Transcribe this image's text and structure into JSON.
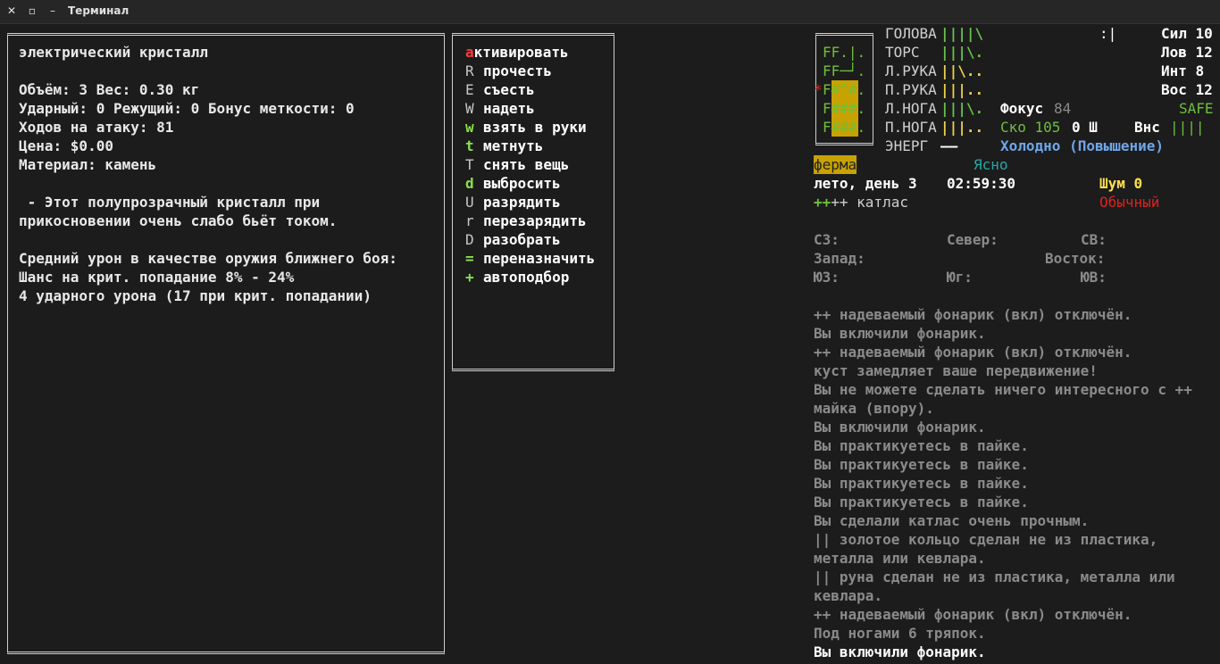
{
  "window": {
    "title": "Терминал",
    "close_icon": "✕",
    "maximize_icon": "▫",
    "minimize_icon": "–"
  },
  "item_info": {
    "name": "электрический кристалл",
    "volume_weight": "Объём: 3 Вес: 0.30 кг",
    "damage": "Ударный: 0 Режущий: 0 Бонус меткости: 0",
    "moves": "Ходов на атаку: 81",
    "price": "Цена: $0.00",
    "material": "Материал: камень",
    "desc_1": " - Этот полупрозрачный кристалл при",
    "desc_2": "прикосновении очень слабо бьёт током.",
    "melee_1": "Средний урон в качестве оружия ближнего боя:",
    "melee_2": "Шанс на крит. попадание 8% - 24%",
    "melee_3": "4 ударного урона (17 при крит. попадании)"
  },
  "actions": [
    {
      "key": "a",
      "label": "ктивировать",
      "style": "red"
    },
    {
      "key": "R",
      "label": "прочесть",
      "style": "gray"
    },
    {
      "key": "E",
      "label": "съесть",
      "style": "gray"
    },
    {
      "key": "W",
      "label": "надеть",
      "style": "gray"
    },
    {
      "key": "w",
      "label": "взять в руки",
      "style": "green"
    },
    {
      "key": "t",
      "label": "метнуть",
      "style": "green"
    },
    {
      "key": "T",
      "label": "снять вещь",
      "style": "gray"
    },
    {
      "key": "d",
      "label": "выбросить",
      "style": "green"
    },
    {
      "key": "U",
      "label": "разрядить",
      "style": "gray"
    },
    {
      "key": "r",
      "label": "перезарядить",
      "style": "gray"
    },
    {
      "key": "D",
      "label": "разобрать",
      "style": "gray"
    },
    {
      "key": "=",
      "label": "переназначить",
      "style": "green"
    },
    {
      "key": "+",
      "label": "автоподбор",
      "style": "green"
    }
  ],
  "portrait": {
    "rows": [
      "FF.|.",
      "FF─┘.",
      "F#^#.",
      "F###.",
      "F###."
    ],
    "marker": "*"
  },
  "body": [
    {
      "part": "ГОЛОВА",
      "bar": "||||\\"
    },
    {
      "part": "ТОРС",
      "bar": "|||\\."
    },
    {
      "part": "Л.РУКА",
      "bar": "||\\.."
    },
    {
      "part": "П.РУКА",
      "bar": "|||.."
    },
    {
      "part": "Л.НОГА",
      "bar": "|||\\."
    },
    {
      "part": "П.НОГА",
      "bar": "|||.."
    },
    {
      "part": "ЭНЕРГ",
      "bar": "——"
    }
  ],
  "stats": {
    "mood": ":|",
    "str": "Сил 10",
    "dex": "Лов 12",
    "int": "Инт 8",
    "per": "Вос 12",
    "focus_label": "Фокус",
    "focus_value": "84",
    "safe": "SAFE",
    "speed": "Ско 105",
    "move_mode": "0 Ш",
    "will_label": "Внс",
    "will_bar": "||||",
    "temperature": "Холодно (Повышение)"
  },
  "location": {
    "place": "ферма",
    "weather": "Ясно",
    "date": "лето, день 3",
    "time": "02:59:30",
    "noise": "Шум 0",
    "wielded": "++ катлас",
    "mode": "Обычный"
  },
  "compass": {
    "nw": "СЗ:",
    "n": "Север:",
    "ne": "СВ:",
    "w": "Запад:",
    "e": "Восток:",
    "sw": "ЮЗ:",
    "s": "Юг:",
    "se": "ЮВ:"
  },
  "log": [
    "++ надеваемый фонарик (вкл) отключён.",
    "Вы включили фонарик.",
    "++ надеваемый фонарик (вкл) отключён.",
    "куст замедляет ваше передвижение!",
    "Вы не можете сделать ничего интересного с ++",
    "майка (впору).",
    "Вы включили фонарик.",
    "Вы практикуетесь в пайке.",
    "Вы практикуетесь в пайке.",
    "Вы практикуетесь в пайке.",
    "Вы практикуетесь в пайке.",
    "Вы сделали катлас очень прочным.",
    "|| золотое кольцо сделан не из пластика,",
    "металла или кевлара.",
    "|| руна сделан не из пластика, металла или",
    "кевлара.",
    "++ надеваемый фонарик (вкл) отключён.",
    "Под ногами 6 тряпок.",
    "Вы включили фонарик."
  ]
}
